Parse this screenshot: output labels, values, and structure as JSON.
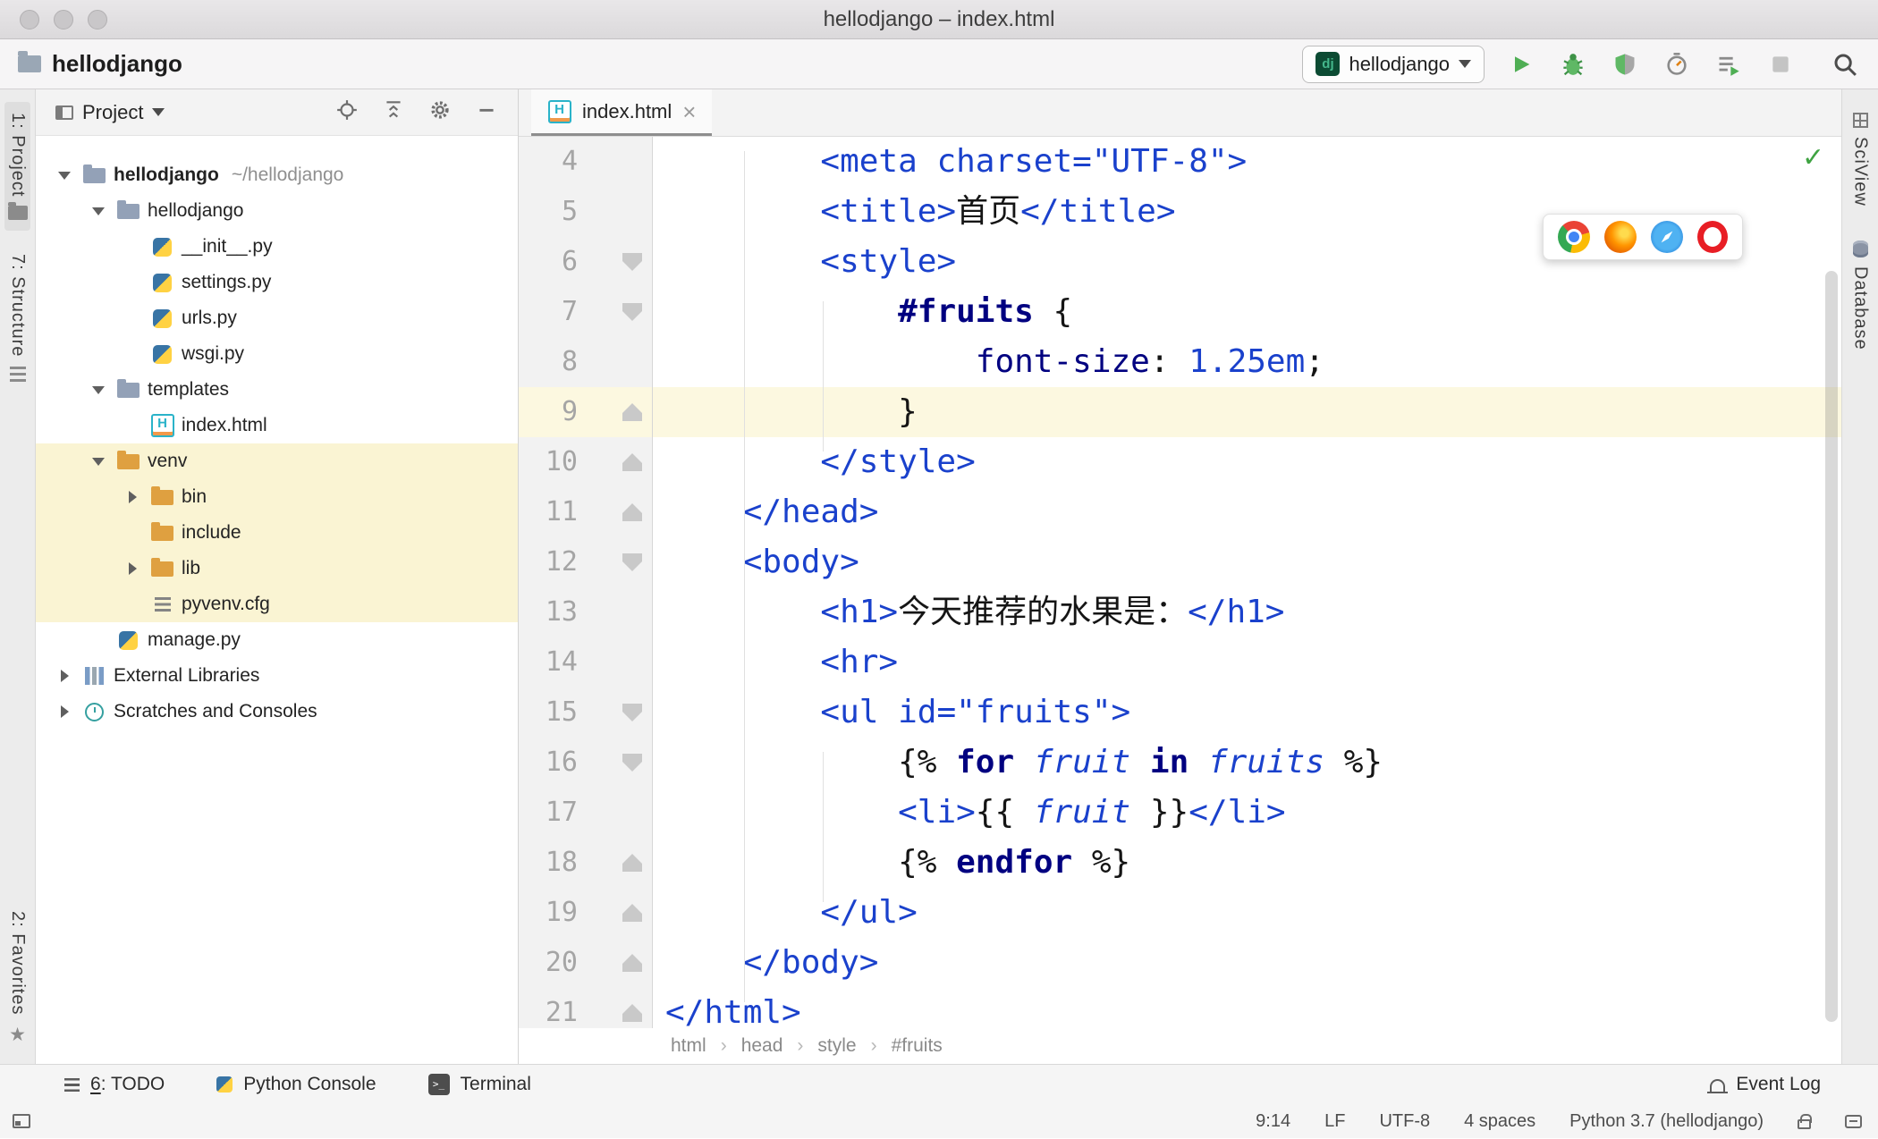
{
  "window": {
    "title": "hellodjango – index.html",
    "traffic_lights": [
      "close",
      "minimize",
      "zoom"
    ]
  },
  "toolbar": {
    "project_name": "hellodjango",
    "run_config": {
      "label": "hellodjango",
      "icon": "django-icon"
    },
    "buttons": [
      "play-icon",
      "bug-icon",
      "coverage-icon",
      "profiler-icon",
      "run-tasks-icon",
      "stop-icon",
      "search-icon"
    ]
  },
  "left_strip": [
    {
      "label": "1: Project",
      "icon": "project-tool-icon",
      "active": true,
      "bottom": false
    },
    {
      "label": "7: Structure",
      "icon": "structure-tool-icon",
      "active": false,
      "bottom": false
    },
    {
      "label": "2: Favorites",
      "icon": "favorites-tool-icon",
      "active": false,
      "bottom": true
    }
  ],
  "right_strip": [
    {
      "label": "SciView",
      "icon": "sciview-tool-icon"
    },
    {
      "label": "Database",
      "icon": "database-tool-icon"
    }
  ],
  "project_panel": {
    "title": "Project",
    "header_icons": [
      "locate-icon",
      "collapse-all-icon",
      "settings-icon",
      "hide-icon"
    ],
    "tree": [
      {
        "label": "hellodjango",
        "suffix": "~/hellodjango",
        "indent": 0,
        "arrow": "down",
        "icon": "folder",
        "bold": true,
        "highlight": false
      },
      {
        "label": "hellodjango",
        "suffix": null,
        "indent": 1,
        "arrow": "down",
        "icon": "folder",
        "bold": false,
        "highlight": false
      },
      {
        "label": "__init__.py",
        "suffix": null,
        "indent": 2,
        "arrow": null,
        "icon": "python-file",
        "bold": false,
        "highlight": false
      },
      {
        "label": "settings.py",
        "suffix": null,
        "indent": 2,
        "arrow": null,
        "icon": "python-file",
        "bold": false,
        "highlight": false
      },
      {
        "label": "urls.py",
        "suffix": null,
        "indent": 2,
        "arrow": null,
        "icon": "python-file",
        "bold": false,
        "highlight": false
      },
      {
        "label": "wsgi.py",
        "suffix": null,
        "indent": 2,
        "arrow": null,
        "icon": "python-file",
        "bold": false,
        "highlight": false
      },
      {
        "label": "templates",
        "suffix": null,
        "indent": 1,
        "arrow": "down",
        "icon": "folder",
        "bold": false,
        "highlight": false
      },
      {
        "label": "index.html",
        "suffix": null,
        "indent": 2,
        "arrow": null,
        "icon": "html-file",
        "bold": false,
        "highlight": false
      },
      {
        "label": "venv",
        "suffix": null,
        "indent": 1,
        "arrow": "down",
        "icon": "folder-excluded",
        "bold": false,
        "highlight": true
      },
      {
        "label": "bin",
        "suffix": null,
        "indent": 2,
        "arrow": "right",
        "icon": "folder-excluded",
        "bold": false,
        "highlight": true
      },
      {
        "label": "include",
        "suffix": null,
        "indent": 2,
        "arrow": null,
        "icon": "folder-excluded",
        "bold": false,
        "highlight": true
      },
      {
        "label": "lib",
        "suffix": null,
        "indent": 2,
        "arrow": "right",
        "icon": "folder-excluded",
        "bold": false,
        "highlight": true
      },
      {
        "label": "pyvenv.cfg",
        "suffix": null,
        "indent": 2,
        "arrow": null,
        "icon": "config-file",
        "bold": false,
        "highlight": true
      },
      {
        "label": "manage.py",
        "suffix": null,
        "indent": 1,
        "arrow": null,
        "icon": "python-file",
        "bold": false,
        "highlight": false
      },
      {
        "label": "External Libraries",
        "suffix": null,
        "indent": 0,
        "arrow": "right",
        "icon": "libraries",
        "bold": false,
        "highlight": false
      },
      {
        "label": "Scratches and Consoles",
        "suffix": null,
        "indent": 0,
        "arrow": "right",
        "icon": "scratches",
        "bold": false,
        "highlight": false
      }
    ]
  },
  "editor": {
    "tab": {
      "title": "index.html",
      "icon": "html-file"
    },
    "inspection_status": "ok",
    "browser_popup": [
      "chrome",
      "firefox",
      "safari",
      "opera"
    ],
    "breadcrumb_separator": "›",
    "breadcrumbs": [
      "html",
      "head",
      "style",
      "#fruits"
    ],
    "lines": [
      {
        "n": 4,
        "fold": null,
        "active": false,
        "tokens": [
          [
            "ws",
            "        "
          ],
          [
            "tag",
            "<meta "
          ],
          [
            "attr",
            "charset="
          ],
          [
            "val",
            "\"UTF-8\""
          ],
          [
            "tag",
            ">"
          ]
        ]
      },
      {
        "n": 5,
        "fold": null,
        "active": false,
        "tokens": [
          [
            "ws",
            "        "
          ],
          [
            "tag",
            "<title>"
          ],
          [
            "txt",
            "首页"
          ],
          [
            "tag",
            "</title>"
          ]
        ]
      },
      {
        "n": 6,
        "fold": "open",
        "active": false,
        "tokens": [
          [
            "ws",
            "        "
          ],
          [
            "tag",
            "<style>"
          ]
        ]
      },
      {
        "n": 7,
        "fold": "open",
        "active": false,
        "tokens": [
          [
            "ws",
            "            "
          ],
          [
            "sel",
            "#fruits"
          ],
          [
            "txt",
            " {"
          ]
        ]
      },
      {
        "n": 8,
        "fold": null,
        "active": false,
        "tokens": [
          [
            "ws",
            "                "
          ],
          [
            "prop",
            "font-size"
          ],
          [
            "txt",
            ": "
          ],
          [
            "num",
            "1.25em"
          ],
          [
            "txt",
            ";"
          ]
        ]
      },
      {
        "n": 9,
        "fold": "close",
        "active": true,
        "tokens": [
          [
            "ws",
            "            "
          ],
          [
            "txt",
            "}"
          ]
        ]
      },
      {
        "n": 10,
        "fold": "close",
        "active": false,
        "tokens": [
          [
            "ws",
            "        "
          ],
          [
            "tag",
            "</style>"
          ]
        ]
      },
      {
        "n": 11,
        "fold": "close",
        "active": false,
        "tokens": [
          [
            "ws",
            "    "
          ],
          [
            "tag",
            "</head>"
          ]
        ]
      },
      {
        "n": 12,
        "fold": "open",
        "active": false,
        "tokens": [
          [
            "ws",
            "    "
          ],
          [
            "tag",
            "<body>"
          ]
        ]
      },
      {
        "n": 13,
        "fold": null,
        "active": false,
        "tokens": [
          [
            "ws",
            "        "
          ],
          [
            "tag",
            "<h1>"
          ],
          [
            "txt",
            "今天推荐的水果是："
          ],
          [
            "tag",
            "</h1>"
          ]
        ]
      },
      {
        "n": 14,
        "fold": null,
        "active": false,
        "tokens": [
          [
            "ws",
            "        "
          ],
          [
            "tag",
            "<hr>"
          ]
        ]
      },
      {
        "n": 15,
        "fold": "open",
        "active": false,
        "tokens": [
          [
            "ws",
            "        "
          ],
          [
            "tag",
            "<ul "
          ],
          [
            "attr",
            "id="
          ],
          [
            "val",
            "\"fruits\""
          ],
          [
            "tag",
            ">"
          ]
        ]
      },
      {
        "n": 16,
        "fold": "open",
        "active": false,
        "tokens": [
          [
            "ws",
            "            "
          ],
          [
            "brace",
            "{% "
          ],
          [
            "kw",
            "for"
          ],
          [
            "txt",
            " "
          ],
          [
            "var",
            "fruit"
          ],
          [
            "txt",
            " "
          ],
          [
            "kw",
            "in"
          ],
          [
            "txt",
            " "
          ],
          [
            "var",
            "fruits"
          ],
          [
            "txt",
            " "
          ],
          [
            "brace",
            "%}"
          ]
        ]
      },
      {
        "n": 17,
        "fold": null,
        "active": false,
        "tokens": [
          [
            "ws",
            "            "
          ],
          [
            "tag",
            "<li>"
          ],
          [
            "brace",
            "{{ "
          ],
          [
            "var",
            "fruit"
          ],
          [
            "brace",
            " }}"
          ],
          [
            "tag",
            "</li>"
          ]
        ]
      },
      {
        "n": 18,
        "fold": "close",
        "active": false,
        "tokens": [
          [
            "ws",
            "            "
          ],
          [
            "brace",
            "{% "
          ],
          [
            "kw",
            "endfor"
          ],
          [
            "brace",
            " %}"
          ]
        ]
      },
      {
        "n": 19,
        "fold": "close",
        "active": false,
        "tokens": [
          [
            "ws",
            "        "
          ],
          [
            "tag",
            "</ul>"
          ]
        ]
      },
      {
        "n": 20,
        "fold": "close",
        "active": false,
        "tokens": [
          [
            "ws",
            "    "
          ],
          [
            "tag",
            "</body>"
          ]
        ]
      },
      {
        "n": 21,
        "fold": "close",
        "active": false,
        "tokens": [
          [
            "ws",
            ""
          ],
          [
            "tag",
            "</html>"
          ]
        ]
      }
    ]
  },
  "tool_window_bar": {
    "left": [
      {
        "label": "6: TODO",
        "icon": "todo-icon",
        "mnemonic": "6"
      },
      {
        "label": "Python Console",
        "icon": "python-icon",
        "mnemonic": null
      },
      {
        "label": "Terminal",
        "icon": "terminal-icon",
        "mnemonic": null
      }
    ],
    "right": [
      {
        "label": "Event Log",
        "icon": "event-log-icon",
        "mnemonic": null
      }
    ]
  },
  "status_bar": {
    "items": [
      "9:14",
      "LF",
      "UTF-8",
      "4 spaces",
      "Python 3.7 (hellodjango)"
    ],
    "icons": [
      "lock-icon",
      "reader-mode-icon"
    ]
  }
}
